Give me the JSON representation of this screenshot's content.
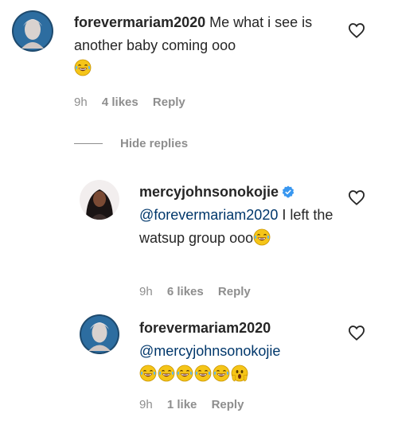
{
  "comments": [
    {
      "username": "forevermariam2020",
      "text": " Me what i see is another baby coming ooo",
      "time": "9h",
      "likes": "4 likes",
      "reply": "Reply"
    },
    {
      "username": "mercyjohnsonokojie",
      "mention": "@forevermariam2020",
      "text": " I left the watsup group ooo",
      "time": "9h",
      "likes": "6 likes",
      "reply": "Reply"
    },
    {
      "username": "forevermariam2020",
      "mention": "@mercyjohnsonokojie",
      "time": "9h",
      "likes": "1 like",
      "reply": "Reply"
    }
  ],
  "hide_replies": "Hide replies",
  "icons": {
    "like": "heart-outline-icon",
    "verified": "verified-badge-icon",
    "laugh": "face-with-tears-of-joy-emoji",
    "hands": "face-screaming-emoji"
  },
  "colors": {
    "text": "#262626",
    "meta": "#8e8e8e",
    "mention": "#00376b",
    "verified": "#3897f0",
    "emoji": "#f5c518"
  }
}
